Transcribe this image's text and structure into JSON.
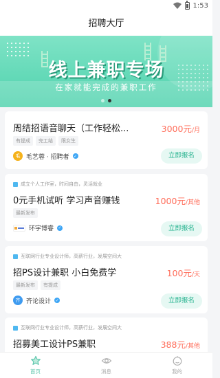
{
  "status_bar": {
    "time": "1:53"
  },
  "header": {
    "title": "招聘大厅"
  },
  "banner": {
    "title": "线上兼职专场",
    "subtitle": "在家就能完成的兼职工作",
    "slide_count": 2,
    "active_slide": 1
  },
  "jobs": [
    {
      "hint": "",
      "title": "周结招语音聊天（工作轻松...",
      "price": "3000元",
      "unit": "/月",
      "tags": [
        "有提成",
        "完工结",
        "限女生"
      ],
      "company": "毛艺蓉 · 招聘者",
      "logo_text": "毛",
      "logo_color": "#f5b21b",
      "apply_label": "立即报名"
    },
    {
      "hint": "成立个人工作室，时间自由，灵活就业",
      "title": "0元手机试听 学习声音赚钱",
      "price": "1000元",
      "unit": "/其他",
      "tags": [
        "最新发布"
      ],
      "company": "环宇博睿",
      "logo_text": "",
      "logo_color": "#ffffff",
      "apply_label": "立即报名"
    },
    {
      "hint": "互联网行业专业设计师，高薪行业，发展空间大",
      "title": "招PS设计兼职 小白免费学",
      "price": "100元",
      "unit": "/天",
      "tags": [
        "最新发布",
        "有提成"
      ],
      "company": "齐论设计",
      "logo_text": "齐",
      "logo_color": "#3e9bf0",
      "apply_label": "立即报名"
    },
    {
      "hint": "互联网行业专业设计师，高薪行业，发展空间大",
      "title": "招募美工设计PS兼职",
      "price": "388元",
      "unit": "/其他",
      "tags": [],
      "company": "",
      "logo_text": "",
      "logo_color": "#ffffff",
      "apply_label": ""
    }
  ],
  "bottom_nav": {
    "items": [
      {
        "label": "首页",
        "icon": "star-home-icon",
        "active": true
      },
      {
        "label": "消息",
        "icon": "eye-message-icon",
        "active": false
      },
      {
        "label": "我的",
        "icon": "face-profile-icon",
        "active": false
      }
    ]
  },
  "colors": {
    "accent": "#21b18c",
    "price": "#ff6d5a",
    "banner": "#4fd2ad"
  }
}
